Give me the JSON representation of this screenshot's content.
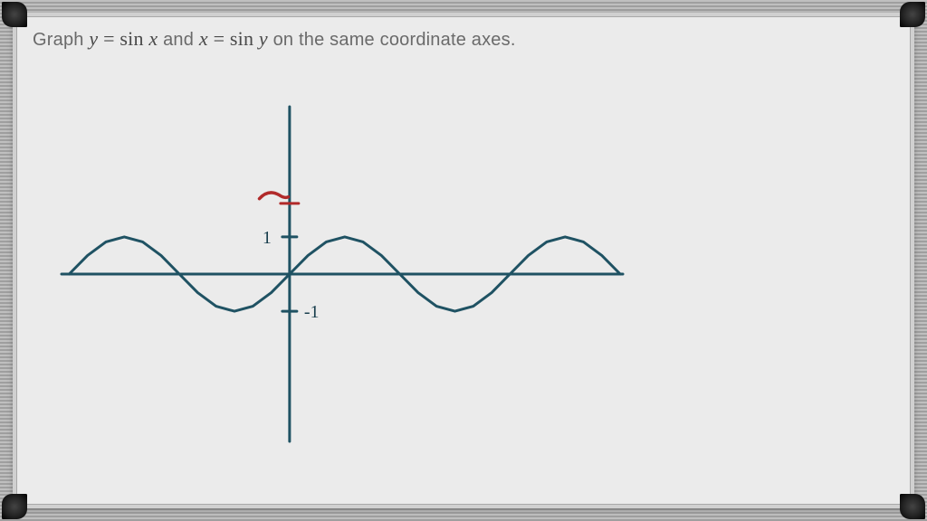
{
  "problem": {
    "prefix": "Graph ",
    "eq1_lhs": "y",
    "eq_sign1": " = ",
    "eq1_fn": "sin ",
    "eq1_arg": "x",
    "mid": " and ",
    "eq2_lhs": "x",
    "eq_sign2": " = ",
    "eq2_fn": "sin ",
    "eq2_arg": "y",
    "suffix": " on the same coordinate axes."
  },
  "chart_data": {
    "type": "line",
    "title": "",
    "xlabel": "",
    "ylabel": "",
    "xlim": [
      -6.5,
      9.5
    ],
    "ylim": [
      -4.5,
      4.5
    ],
    "series": [
      {
        "name": "y = sin x",
        "color": "#1f5263",
        "x": [
          -6.283,
          -5.76,
          -5.236,
          -4.712,
          -4.189,
          -3.665,
          -3.142,
          -2.618,
          -2.094,
          -1.571,
          -1.047,
          -0.524,
          0,
          0.524,
          1.047,
          1.571,
          2.094,
          2.618,
          3.142,
          3.665,
          4.189,
          4.712,
          5.236,
          5.76,
          6.283,
          6.807,
          7.33,
          7.854,
          8.378,
          8.901,
          9.425
        ],
        "y": [
          0.0,
          0.5,
          0.866,
          1.0,
          0.866,
          0.5,
          0.0,
          -0.5,
          -0.866,
          -1.0,
          -0.866,
          -0.5,
          0.0,
          0.5,
          0.866,
          1.0,
          0.866,
          0.5,
          0.0,
          -0.5,
          -0.866,
          -1.0,
          -0.866,
          -0.5,
          0.0,
          0.5,
          0.866,
          1.0,
          0.866,
          0.5,
          0.0
        ]
      }
    ],
    "ticks_y": [
      {
        "value": 1,
        "label": "1"
      },
      {
        "value": -1,
        "label": "-1"
      }
    ],
    "annotations": [
      {
        "type": "mark",
        "x": -0.5,
        "y": 2.1,
        "glyph": "~",
        "color": "#b12a2a"
      },
      {
        "type": "tick",
        "axis": "y",
        "value": 1.9,
        "color": "#b12a2a"
      }
    ]
  },
  "colors": {
    "ink": "#1f5263",
    "red": "#b12a2a",
    "board": "#ebebeb",
    "text": "#6a6a6a"
  }
}
